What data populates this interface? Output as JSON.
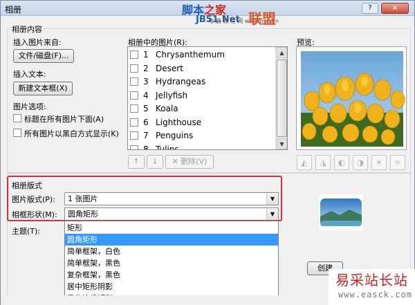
{
  "window": {
    "title": "相册",
    "help_icon": "help-icon",
    "close_icon": "close-icon"
  },
  "watermark": {
    "top_text_blue": "脚本",
    "top_text_red": "之家",
    "top_brand": "JB51.Net",
    "top_sub": "电 脑 教 程 网   wordim.com",
    "top_union": "联盟",
    "bottom_big": "易采站长站",
    "bottom_url": "www.easck.com"
  },
  "album_content": {
    "legend": "相册内容",
    "insert_from_label": "插入图片来自:",
    "file_button": "文件/磁盘(F)...",
    "insert_text_label": "插入文本:",
    "new_textbox_button": "新建文本框(X)",
    "picture_options_label": "图片选项:",
    "option_captions": "标题在所有图片下面(A)",
    "option_blackwhite": "所有图片以黑白方式显示(K)"
  },
  "pictures": {
    "label": "相册中的图片(R):",
    "items": [
      {
        "num": "1",
        "name": "Chrysanthemum"
      },
      {
        "num": "2",
        "name": "Desert"
      },
      {
        "num": "3",
        "name": "Hydrangeas"
      },
      {
        "num": "4",
        "name": "Jellyfish"
      },
      {
        "num": "5",
        "name": "Koala"
      },
      {
        "num": "6",
        "name": "Lighthouse"
      },
      {
        "num": "7",
        "name": "Penguins"
      },
      {
        "num": "8",
        "name": "Tulips"
      }
    ],
    "up_icon": "arrow-up-icon",
    "down_icon": "arrow-down-icon",
    "delete_button": "删除(V)"
  },
  "preview": {
    "label": "预览:"
  },
  "layout": {
    "legend": "相册版式",
    "picture_layout_label": "图片版式(P):",
    "picture_layout_value": "1 张图片",
    "frame_shape_label": "相框形状(M):",
    "frame_shape_value": "圆角矩形",
    "theme_label": "主题(T):",
    "frame_options": [
      {
        "label": "矩形",
        "selected": false
      },
      {
        "label": "圆角矩形",
        "selected": true
      },
      {
        "label": "简单框架，白色",
        "selected": false
      },
      {
        "label": "简单框架，黑色",
        "selected": false
      },
      {
        "label": "复杂框架，黑色",
        "selected": false
      },
      {
        "label": "居中矩形阴影",
        "selected": false
      },
      {
        "label": "柔化边缘矩形",
        "selected": false
      }
    ]
  },
  "footer": {
    "create_button": "创建"
  },
  "colors": {
    "highlight_box": "#d8303a",
    "selection": "#3399ff"
  }
}
